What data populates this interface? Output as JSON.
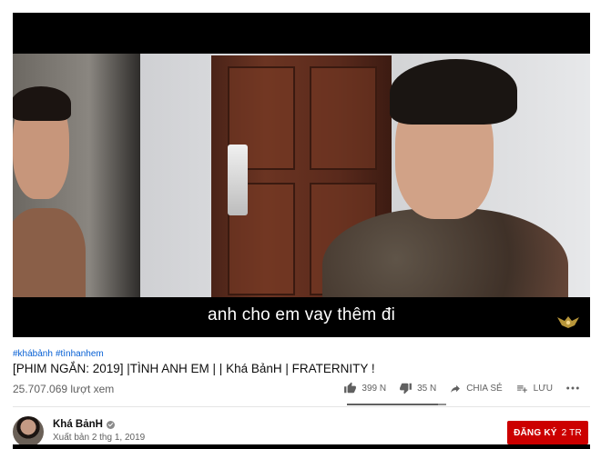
{
  "player": {
    "subtitle": "anh cho em vay thêm đi"
  },
  "video": {
    "hashtags": [
      "#khábảnh",
      "#tìnhanhem"
    ],
    "title": "[PHIM NGẮN: 2019] |TÌNH ANH EM | | Khá BảnH | FRATERNITY !",
    "views": "25.707.069 lượt xem"
  },
  "actions": {
    "like_count": "399 N",
    "dislike_count": "35 N",
    "share_label": "CHIA SẺ",
    "save_label": "LƯU",
    "more_icon": "more-horizontal-icon",
    "like_ratio": 0.92
  },
  "channel": {
    "name": "Khá BảnH",
    "published": "Xuất bản 2 thg 1, 2019",
    "subscribe_label": "ĐĂNG KÝ",
    "subscriber_count": "2 TR"
  },
  "colors": {
    "subscribe": "#cc0000",
    "link": "#065fd4"
  }
}
